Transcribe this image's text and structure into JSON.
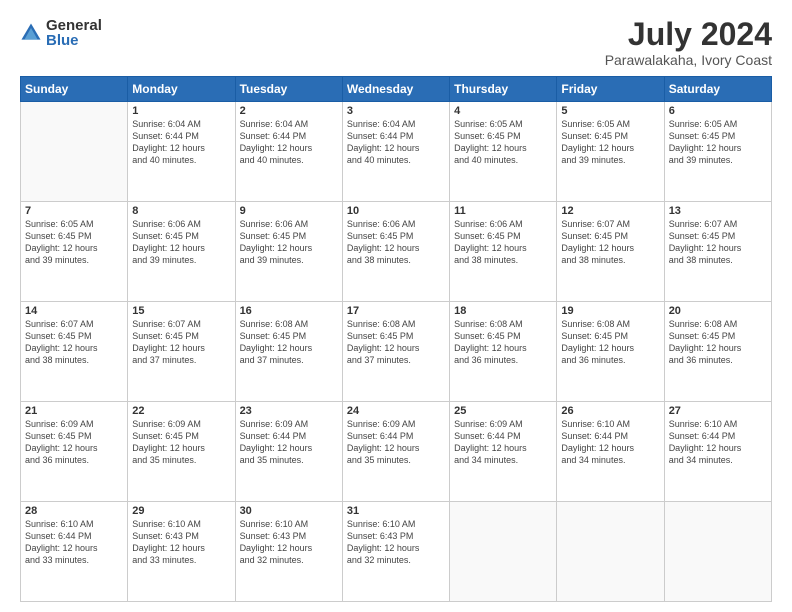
{
  "header": {
    "logo": {
      "general": "General",
      "blue": "Blue"
    },
    "title": "July 2024",
    "location": "Parawalakaha, Ivory Coast"
  },
  "calendar": {
    "weekdays": [
      "Sunday",
      "Monday",
      "Tuesday",
      "Wednesday",
      "Thursday",
      "Friday",
      "Saturday"
    ],
    "weeks": [
      [
        {
          "day": "",
          "info": ""
        },
        {
          "day": "1",
          "info": "Sunrise: 6:04 AM\nSunset: 6:44 PM\nDaylight: 12 hours\nand 40 minutes."
        },
        {
          "day": "2",
          "info": "Sunrise: 6:04 AM\nSunset: 6:44 PM\nDaylight: 12 hours\nand 40 minutes."
        },
        {
          "day": "3",
          "info": "Sunrise: 6:04 AM\nSunset: 6:44 PM\nDaylight: 12 hours\nand 40 minutes."
        },
        {
          "day": "4",
          "info": "Sunrise: 6:05 AM\nSunset: 6:45 PM\nDaylight: 12 hours\nand 40 minutes."
        },
        {
          "day": "5",
          "info": "Sunrise: 6:05 AM\nSunset: 6:45 PM\nDaylight: 12 hours\nand 39 minutes."
        },
        {
          "day": "6",
          "info": "Sunrise: 6:05 AM\nSunset: 6:45 PM\nDaylight: 12 hours\nand 39 minutes."
        }
      ],
      [
        {
          "day": "7",
          "info": "Sunrise: 6:05 AM\nSunset: 6:45 PM\nDaylight: 12 hours\nand 39 minutes."
        },
        {
          "day": "8",
          "info": "Sunrise: 6:06 AM\nSunset: 6:45 PM\nDaylight: 12 hours\nand 39 minutes."
        },
        {
          "day": "9",
          "info": "Sunrise: 6:06 AM\nSunset: 6:45 PM\nDaylight: 12 hours\nand 39 minutes."
        },
        {
          "day": "10",
          "info": "Sunrise: 6:06 AM\nSunset: 6:45 PM\nDaylight: 12 hours\nand 38 minutes."
        },
        {
          "day": "11",
          "info": "Sunrise: 6:06 AM\nSunset: 6:45 PM\nDaylight: 12 hours\nand 38 minutes."
        },
        {
          "day": "12",
          "info": "Sunrise: 6:07 AM\nSunset: 6:45 PM\nDaylight: 12 hours\nand 38 minutes."
        },
        {
          "day": "13",
          "info": "Sunrise: 6:07 AM\nSunset: 6:45 PM\nDaylight: 12 hours\nand 38 minutes."
        }
      ],
      [
        {
          "day": "14",
          "info": "Sunrise: 6:07 AM\nSunset: 6:45 PM\nDaylight: 12 hours\nand 38 minutes."
        },
        {
          "day": "15",
          "info": "Sunrise: 6:07 AM\nSunset: 6:45 PM\nDaylight: 12 hours\nand 37 minutes."
        },
        {
          "day": "16",
          "info": "Sunrise: 6:08 AM\nSunset: 6:45 PM\nDaylight: 12 hours\nand 37 minutes."
        },
        {
          "day": "17",
          "info": "Sunrise: 6:08 AM\nSunset: 6:45 PM\nDaylight: 12 hours\nand 37 minutes."
        },
        {
          "day": "18",
          "info": "Sunrise: 6:08 AM\nSunset: 6:45 PM\nDaylight: 12 hours\nand 36 minutes."
        },
        {
          "day": "19",
          "info": "Sunrise: 6:08 AM\nSunset: 6:45 PM\nDaylight: 12 hours\nand 36 minutes."
        },
        {
          "day": "20",
          "info": "Sunrise: 6:08 AM\nSunset: 6:45 PM\nDaylight: 12 hours\nand 36 minutes."
        }
      ],
      [
        {
          "day": "21",
          "info": "Sunrise: 6:09 AM\nSunset: 6:45 PM\nDaylight: 12 hours\nand 36 minutes."
        },
        {
          "day": "22",
          "info": "Sunrise: 6:09 AM\nSunset: 6:45 PM\nDaylight: 12 hours\nand 35 minutes."
        },
        {
          "day": "23",
          "info": "Sunrise: 6:09 AM\nSunset: 6:44 PM\nDaylight: 12 hours\nand 35 minutes."
        },
        {
          "day": "24",
          "info": "Sunrise: 6:09 AM\nSunset: 6:44 PM\nDaylight: 12 hours\nand 35 minutes."
        },
        {
          "day": "25",
          "info": "Sunrise: 6:09 AM\nSunset: 6:44 PM\nDaylight: 12 hours\nand 34 minutes."
        },
        {
          "day": "26",
          "info": "Sunrise: 6:10 AM\nSunset: 6:44 PM\nDaylight: 12 hours\nand 34 minutes."
        },
        {
          "day": "27",
          "info": "Sunrise: 6:10 AM\nSunset: 6:44 PM\nDaylight: 12 hours\nand 34 minutes."
        }
      ],
      [
        {
          "day": "28",
          "info": "Sunrise: 6:10 AM\nSunset: 6:44 PM\nDaylight: 12 hours\nand 33 minutes."
        },
        {
          "day": "29",
          "info": "Sunrise: 6:10 AM\nSunset: 6:43 PM\nDaylight: 12 hours\nand 33 minutes."
        },
        {
          "day": "30",
          "info": "Sunrise: 6:10 AM\nSunset: 6:43 PM\nDaylight: 12 hours\nand 32 minutes."
        },
        {
          "day": "31",
          "info": "Sunrise: 6:10 AM\nSunset: 6:43 PM\nDaylight: 12 hours\nand 32 minutes."
        },
        {
          "day": "",
          "info": ""
        },
        {
          "day": "",
          "info": ""
        },
        {
          "day": "",
          "info": ""
        }
      ]
    ]
  }
}
